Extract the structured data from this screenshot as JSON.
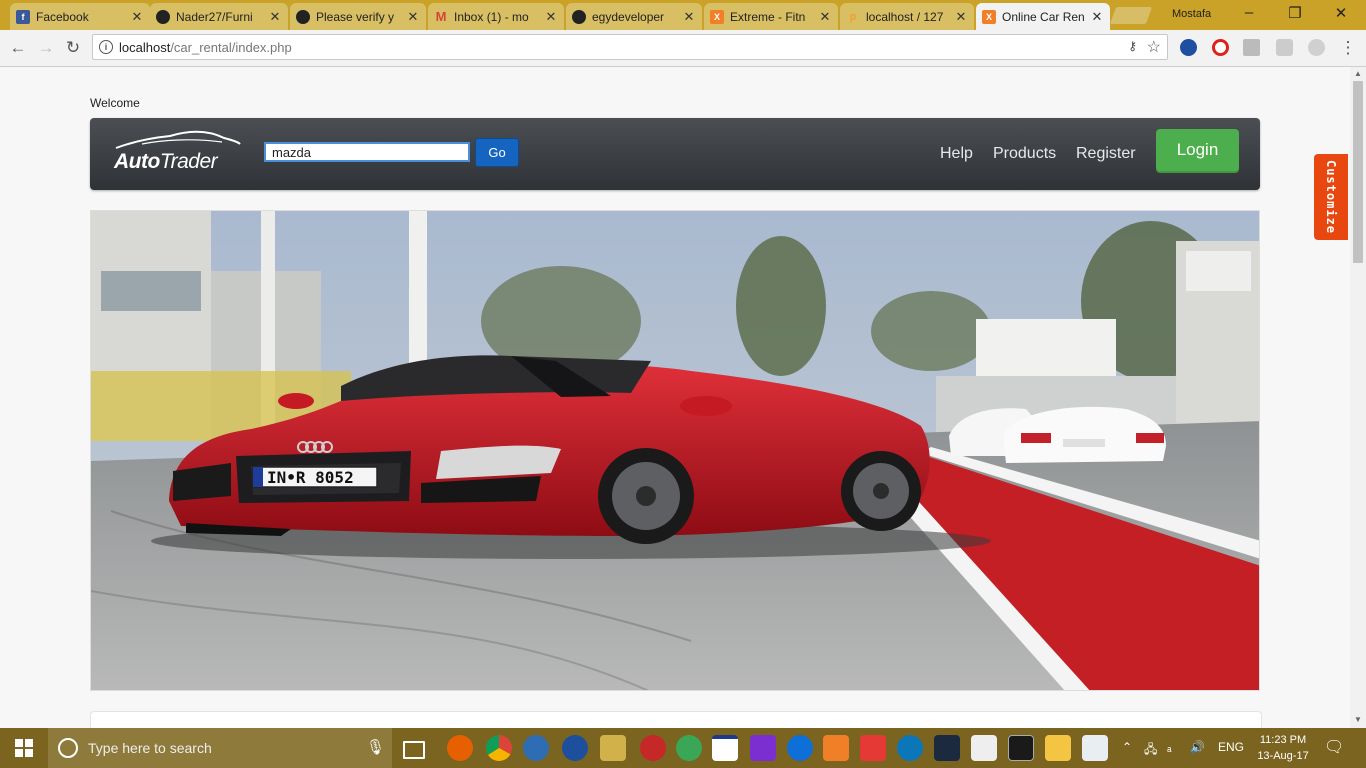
{
  "browser": {
    "tabs": [
      {
        "title": "Facebook",
        "icon": "facebook-icon",
        "color": "#3b5998",
        "glyph": "f"
      },
      {
        "title": "Nader27/Furni",
        "icon": "github-icon",
        "color": "#222222",
        "glyph": "●"
      },
      {
        "title": "Please verify y",
        "icon": "github-icon",
        "color": "#222222",
        "glyph": "●"
      },
      {
        "title": "Inbox (1) - mo",
        "icon": "gmail-icon",
        "color": "#d44638",
        "glyph": "M"
      },
      {
        "title": "egydeveloper",
        "icon": "github-icon",
        "color": "#222222",
        "glyph": "●"
      },
      {
        "title": "Extreme - Fitn",
        "icon": "xampp-icon",
        "color": "#f07f27",
        "glyph": "X"
      },
      {
        "title": "localhost / 127",
        "icon": "phpmyadmin-icon",
        "color": "#f0a030",
        "glyph": "p"
      },
      {
        "title": "Online Car Ren",
        "icon": "xampp-icon",
        "color": "#f07f27",
        "glyph": "X"
      }
    ],
    "active_tab_index": 7,
    "user_name": "Mostafa",
    "url_host": "localhost",
    "url_path": "/car_rental/index.php"
  },
  "page": {
    "welcome": "Welcome",
    "logo_word1": "Auto",
    "logo_word2": "Trader",
    "search": {
      "value": "mazda",
      "button_label": "Go"
    },
    "nav_links": [
      "Help",
      "Products",
      "Register"
    ],
    "login_label": "Login",
    "hero_plate": "IN•R 8052",
    "customize_label": "Customize"
  },
  "taskbar": {
    "search_placeholder": "Type here to search",
    "language": "ENG",
    "time": "11:23 PM",
    "date": "13-Aug-17"
  },
  "colors": {
    "tabstrip": "#c9a227",
    "navbar": "#3b3e42",
    "go_button": "#1565c0",
    "login_button": "#4cae4c",
    "customize_tab": "#e8480f",
    "taskbar": "#7a6420"
  }
}
